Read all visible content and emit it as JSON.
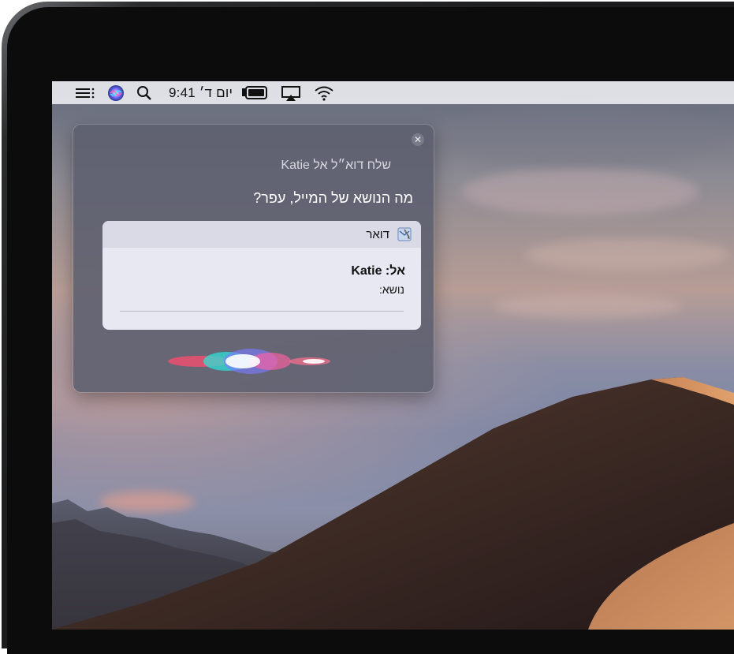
{
  "menubar": {
    "clock": "יום ד׳ 9:41",
    "icons": [
      "wifi-icon",
      "airplay-icon",
      "battery-icon",
      "clock",
      "spotlight-search-icon",
      "siri-icon",
      "notification-center-icon"
    ]
  },
  "siri": {
    "request": "שלח דוא״ל אל Katie",
    "reply": "מה הנושא של המייל, עפר?",
    "card": {
      "app_name": "דואר",
      "app_icon": "mail-app-icon",
      "to_label": "אל:",
      "to_value": "Katie",
      "subject_label": "נושא:"
    },
    "close_icon": "close-icon"
  },
  "colors": {
    "siri_panel": "#5c5e6e",
    "card_bg": "#e7e8f1",
    "menubar_bg": "#e8e9ee"
  }
}
